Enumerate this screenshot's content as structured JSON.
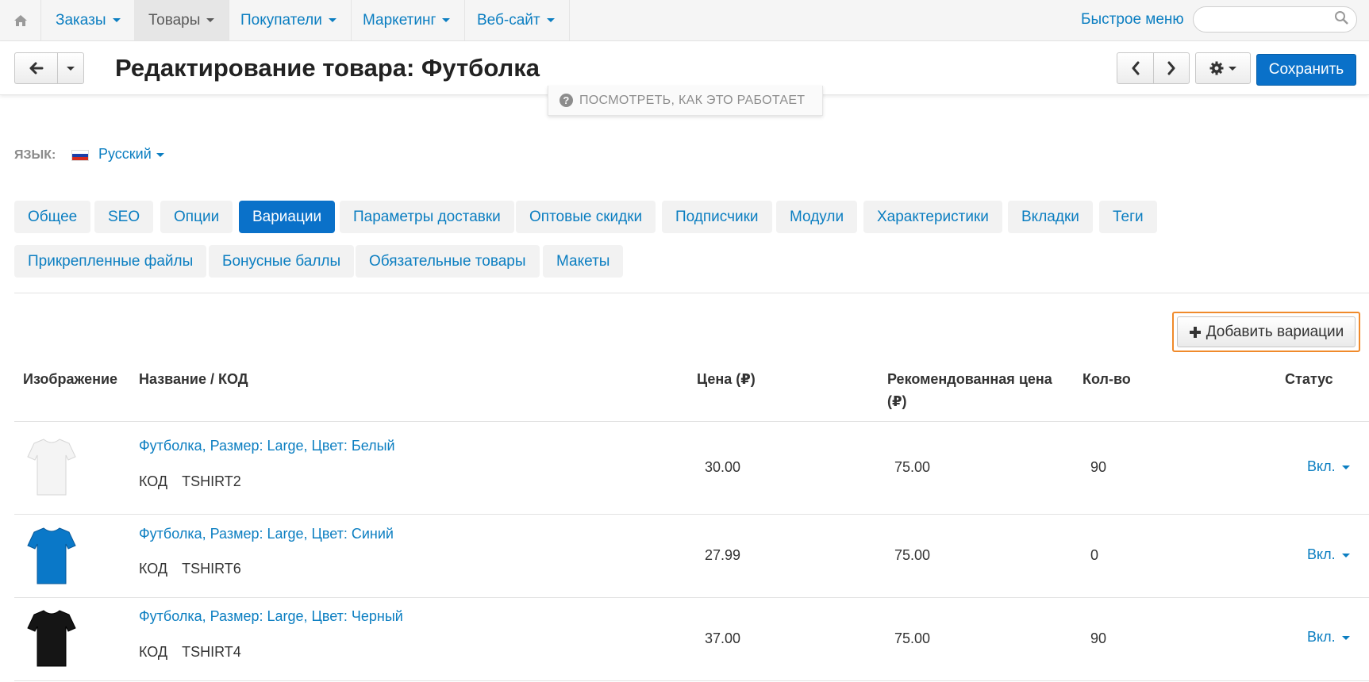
{
  "nav": {
    "items": [
      {
        "label": "Заказы",
        "active": false
      },
      {
        "label": "Товары",
        "active": true
      },
      {
        "label": "Покупатели",
        "active": false
      },
      {
        "label": "Маркетинг",
        "active": false
      },
      {
        "label": "Веб-сайт",
        "active": false
      }
    ],
    "quick_menu": "Быстрое меню",
    "search_placeholder": ""
  },
  "header": {
    "title": "Редактирование товара: Футболка",
    "save_label": "Сохранить",
    "howto": "ПОСМОТРЕТЬ, КАК ЭТО РАБОТАЕТ"
  },
  "language": {
    "label": "ЯЗЫК:",
    "value": "Русский"
  },
  "tabs": [
    {
      "label": "Общее",
      "active": false
    },
    {
      "label": "SEO",
      "active": false
    },
    {
      "label": "Опции",
      "active": false
    },
    {
      "label": "Вариации",
      "active": true
    },
    {
      "label": "Параметры доставки",
      "active": false
    },
    {
      "label": "Оптовые скидки",
      "active": false
    },
    {
      "label": "Подписчики",
      "active": false
    },
    {
      "label": "Модули",
      "active": false
    },
    {
      "label": "Характеристики",
      "active": false
    },
    {
      "label": "Вкладки",
      "active": false
    },
    {
      "label": "Теги",
      "active": false
    },
    {
      "label": "Прикрепленные файлы",
      "active": false
    },
    {
      "label": "Бонусные баллы",
      "active": false
    },
    {
      "label": "Обязательные товары",
      "active": false
    },
    {
      "label": "Макеты",
      "active": false
    }
  ],
  "add_variations_label": "Добавить вариации",
  "table": {
    "headers": {
      "image": "Изображение",
      "name": "Название / КОД",
      "price": "Цена (₽)",
      "rec_price_line1": "Рекомендованная цена",
      "rec_price_line2": "(₽)",
      "qty": "Кол-во",
      "status": "Статус"
    },
    "code_label": "КОД",
    "rows": [
      {
        "name": "Футболка, Размер: Large, Цвет: Белый",
        "code": "TSHIRT2",
        "price": "30.00",
        "rec_price": "75.00",
        "qty": "90",
        "status": "Вкл.",
        "shirt_color": "#f4f4f4"
      },
      {
        "name": "Футболка, Размер: Large, Цвет: Синий",
        "code": "TSHIRT6",
        "price": "27.99",
        "rec_price": "75.00",
        "qty": "0",
        "status": "Вкл.",
        "shirt_color": "#0a78c8"
      },
      {
        "name": "Футболка, Размер: Large, Цвет: Черный",
        "code": "TSHIRT4",
        "price": "37.00",
        "rec_price": "75.00",
        "qty": "90",
        "status": "Вкл.",
        "shirt_color": "#151515"
      }
    ]
  },
  "colors": {
    "accent": "#0a71c9",
    "link": "#0b7ec1",
    "highlight": "#f08a2b"
  }
}
